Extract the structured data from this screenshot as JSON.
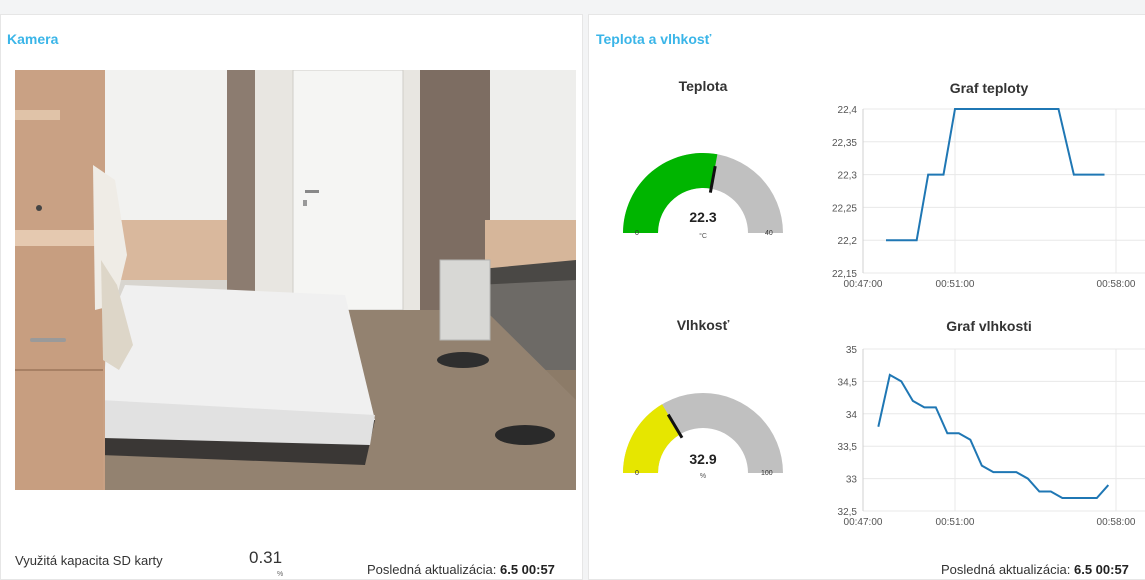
{
  "camera_card": {
    "title": "Kamera",
    "sd_label": "Využitá kapacita SD karty",
    "sd_value": "0.31",
    "sd_unit": "%",
    "updated_label": "Posledná aktualizácia: ",
    "updated_value": "6.5 00:57"
  },
  "env_card": {
    "title": "Teplota a vlhkosť",
    "updated_label": "Posledná aktualizácia: ",
    "updated_value": "6.5 00:57",
    "temp_gauge": {
      "title": "Teplota",
      "value": "22.3",
      "unit": "°C",
      "min": "0",
      "max": "40",
      "fraction": 0.5575,
      "color": "#00b500"
    },
    "hum_gauge": {
      "title": "Vlhkosť",
      "value": "32.9",
      "unit": "%",
      "min": "0",
      "max": "100",
      "fraction": 0.329,
      "color": "#e6e600"
    },
    "temp_chart_title": "Graf teploty",
    "hum_chart_title": "Graf vlhkosti"
  },
  "colors": {
    "accent": "#3ab5e8",
    "line": "#1f77b4",
    "gauge_track": "#c0c0c0"
  },
  "chart_data": [
    {
      "type": "line",
      "title": "Graf teploty",
      "x_ticks": [
        "00:47:00",
        "00:51:00",
        "00:58:00"
      ],
      "y_ticks": [
        "22,15",
        "22,2",
        "22,25",
        "22,3",
        "22,35",
        "22,4"
      ],
      "ylim": [
        22.15,
        22.4
      ],
      "xlim": [
        "00:47:00",
        "00:58:00"
      ],
      "series": [
        {
          "x": [
            "00:48:00",
            "00:49:20",
            "00:49:50",
            "00:50:30",
            "00:51:00",
            "00:53:30",
            "00:55:30",
            "00:56:10",
            "00:57:30"
          ],
          "y": [
            22.2,
            22.2,
            22.3,
            22.3,
            22.4,
            22.4,
            22.4,
            22.3,
            22.3
          ]
        }
      ]
    },
    {
      "type": "line",
      "title": "Graf vlhkosti",
      "x_ticks": [
        "00:47:00",
        "00:51:00",
        "00:58:00"
      ],
      "y_ticks": [
        "32,5",
        "33",
        "33,5",
        "34",
        "34,5",
        "35"
      ],
      "ylim": [
        32.5,
        35
      ],
      "xlim": [
        "00:47:00",
        "00:58:00"
      ],
      "series": [
        {
          "x": [
            "00:47:40",
            "00:48:10",
            "00:48:40",
            "00:49:10",
            "00:49:40",
            "00:50:10",
            "00:50:40",
            "00:51:10",
            "00:51:40",
            "00:52:10",
            "00:52:40",
            "00:53:10",
            "00:53:40",
            "00:54:10",
            "00:54:40",
            "00:55:10",
            "00:55:40",
            "00:56:10",
            "00:56:40",
            "00:57:10",
            "00:57:40"
          ],
          "y": [
            33.8,
            34.6,
            34.5,
            34.2,
            34.1,
            34.1,
            33.7,
            33.7,
            33.6,
            33.2,
            33.1,
            33.1,
            33.1,
            33.0,
            32.8,
            32.8,
            32.7,
            32.7,
            32.7,
            32.7,
            32.9
          ]
        }
      ]
    }
  ]
}
